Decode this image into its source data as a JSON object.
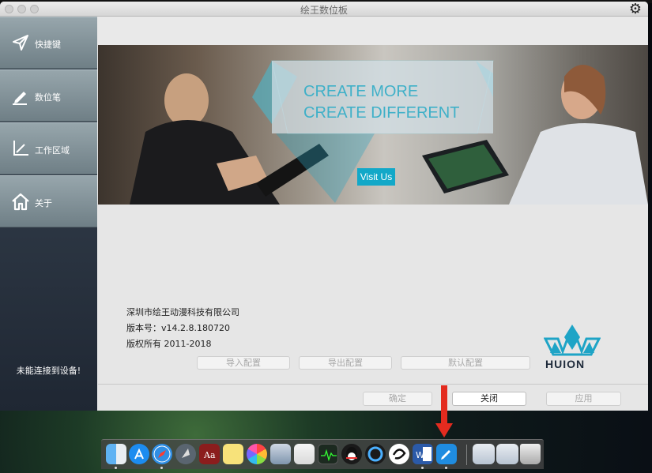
{
  "window": {
    "title": "绘王数位板"
  },
  "sidebar": {
    "items": [
      {
        "label": "快捷键",
        "icon": "send-arrow-icon"
      },
      {
        "label": "数位笔",
        "icon": "pen-icon"
      },
      {
        "label": "工作区域",
        "icon": "area-corner-icon"
      },
      {
        "label": "关于",
        "icon": "home-icon"
      }
    ],
    "status": "未能连接到设备!"
  },
  "banner": {
    "line1": "CREATE MORE",
    "line2": "CREATE DIFFERENT",
    "visit_label": "Visit Us"
  },
  "about": {
    "company": "深圳市绘王动漫科技有限公司",
    "version": "版本号：v14.2.8.180720",
    "copyright": "版权所有 2011-2018",
    "brand": "HUION"
  },
  "config_buttons": {
    "import": "导入配置",
    "export": "导出配置",
    "default": "默认配置"
  },
  "dialog_buttons": {
    "ok": "确定",
    "close": "关闭",
    "apply": "应用"
  },
  "colors": {
    "accent": "#12a8c8",
    "sidebar_item": "#8a9aa0",
    "arrow": "#e32b1f"
  },
  "dock": {
    "icons": [
      "finder-icon",
      "app-store-icon",
      "safari-icon",
      "launchpad-icon",
      "dictionary-icon",
      "notes-icon",
      "photos-icon",
      "preview-icon",
      "textedit-icon",
      "activity-monitor-icon",
      "qq-icon",
      "quicktime-icon",
      "sketch-app-icon",
      "word-icon",
      "huion-tablet-icon",
      "screenshot-1-icon",
      "screenshot-2-icon",
      "trash-icon"
    ]
  }
}
